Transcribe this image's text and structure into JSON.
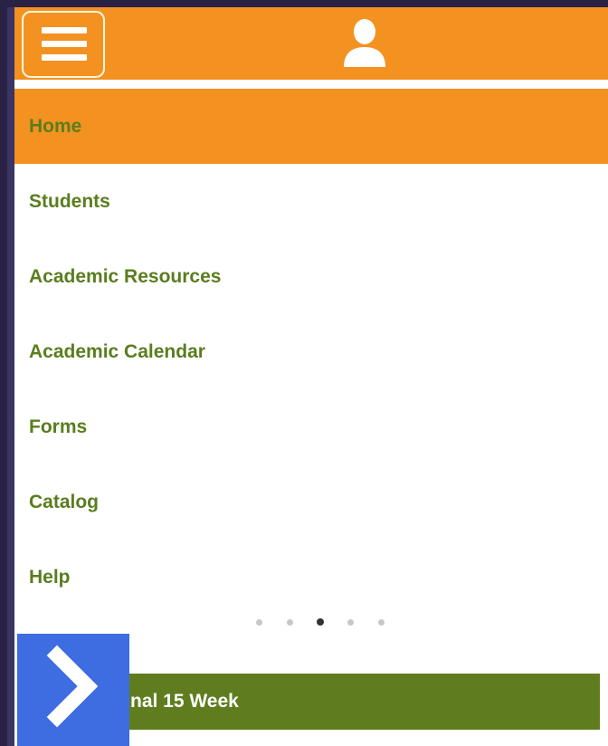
{
  "header": {
    "menu_icon": "hamburger-menu-icon",
    "user_icon": "user-silhouette-icon",
    "brand_color": "#f39220"
  },
  "nav": {
    "items": [
      {
        "label": "Home",
        "active": true
      },
      {
        "label": "Students",
        "active": false
      },
      {
        "label": "Academic Resources",
        "active": false
      },
      {
        "label": "Academic Calendar",
        "active": false
      },
      {
        "label": "Forms",
        "active": false
      },
      {
        "label": "Catalog",
        "active": false
      },
      {
        "label": "Help",
        "active": false
      }
    ],
    "text_color": "#5a7d1e"
  },
  "carousel": {
    "dot_count": 5,
    "active_index": 2
  },
  "banner": {
    "label": "nal 15 Week",
    "color": "#5f7d1e"
  },
  "next_button": {
    "icon": "chevron-right-icon",
    "color": "#3d6de0"
  }
}
